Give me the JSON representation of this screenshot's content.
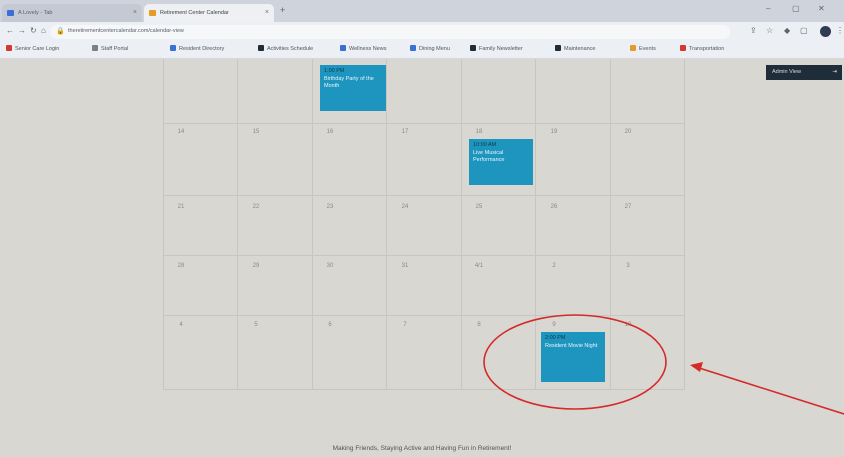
{
  "browser": {
    "tabs": [
      {
        "label": "A Lovely - Tab",
        "active": false
      },
      {
        "label": "Retirement Center Calendar",
        "active": true
      }
    ],
    "url": "theretirementcentercalendar.com/calendar-view",
    "bookmarks": [
      {
        "label": "Senior Care Login",
        "color": "#d33b2f"
      },
      {
        "label": "Staff Portal",
        "color": "#7a7f89"
      },
      {
        "label": "Resident Directory",
        "color": "#3a6fd8"
      },
      {
        "label": "Activities Schedule",
        "color": "#1f2d3a"
      },
      {
        "label": "Wellness News",
        "color": "#3a6fd8"
      },
      {
        "label": "Dining Menu",
        "color": "#3a6fd8"
      },
      {
        "label": "Family Newsletter",
        "color": "#1f2d3a"
      },
      {
        "label": "Maintenance",
        "color": "#1f2d3a"
      },
      {
        "label": "Events",
        "color": "#e79a28"
      },
      {
        "label": "Transportation",
        "color": "#d33b2f"
      }
    ]
  },
  "header": {
    "admin_button": "Admin View",
    "admin_icon": "arrow-right-icon"
  },
  "calendar": {
    "weeks": [
      {
        "days": [
          "",
          "",
          "",
          "",
          "",
          "",
          ""
        ]
      },
      {
        "days": [
          "14",
          "15",
          "16",
          "17",
          "18",
          "19",
          "20"
        ]
      },
      {
        "days": [
          "21",
          "22",
          "23",
          "24",
          "25",
          "26",
          "27"
        ]
      },
      {
        "days": [
          "28",
          "29",
          "30",
          "31",
          "4/1",
          "2",
          "3"
        ]
      },
      {
        "days": [
          "4",
          "5",
          "6",
          "7",
          "8",
          "9",
          "10"
        ]
      }
    ],
    "events": [
      {
        "time": "1:00 PM",
        "title": "Birthday Party of the Month"
      },
      {
        "time": "10:00 AM",
        "title": "Live Musical Performance"
      },
      {
        "time": "2:00 PM",
        "title": "Resident Movie Night"
      }
    ]
  },
  "footer": {
    "tagline": "Making Friends, Staying Active and Having Fun in Retirement!"
  },
  "colors": {
    "event_bg": "#1e95bf",
    "annotation": "#d42a2a"
  }
}
